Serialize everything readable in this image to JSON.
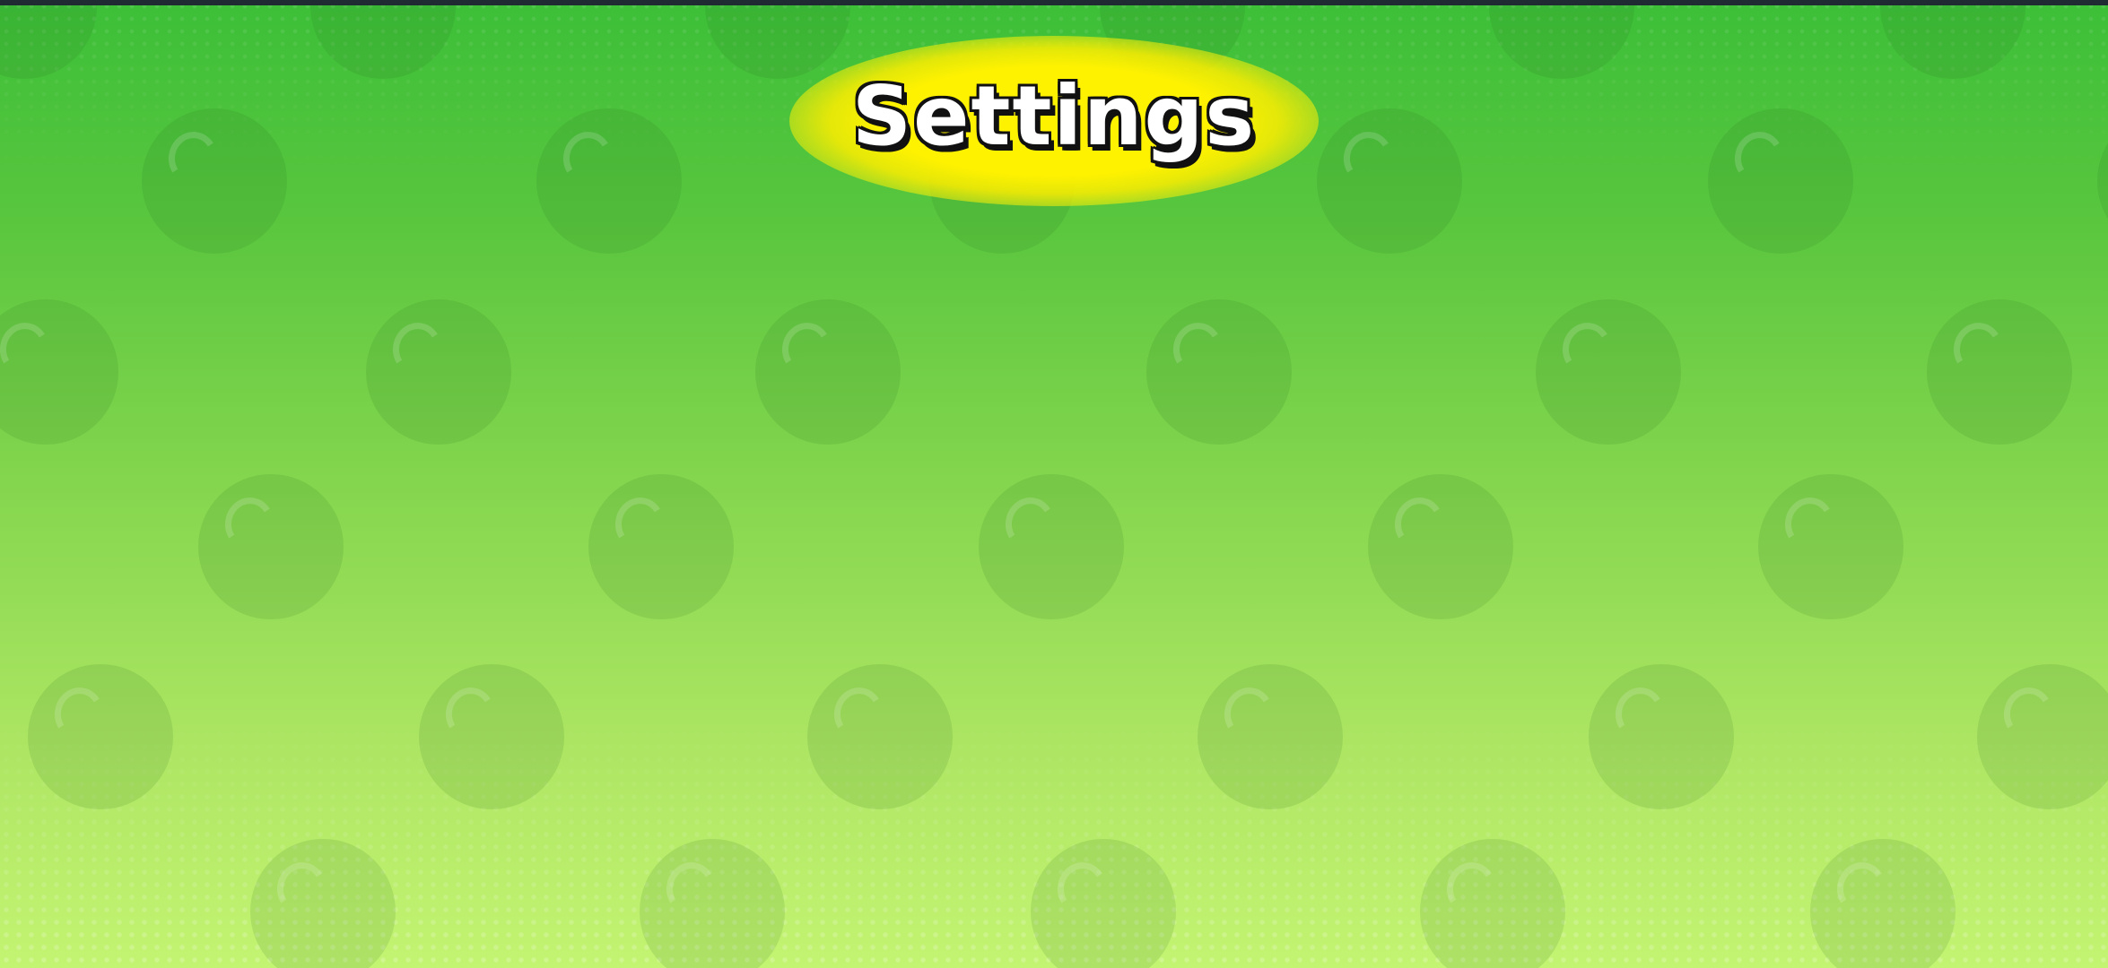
{
  "screen": {
    "title": "Settings"
  },
  "theme": {
    "background_top": "#3cbf38",
    "background_bottom": "#c3f472",
    "title_glow": "#fff200",
    "title_text": "#ffffff",
    "title_outline": "#111111",
    "top_strip": "#1f2a33"
  }
}
